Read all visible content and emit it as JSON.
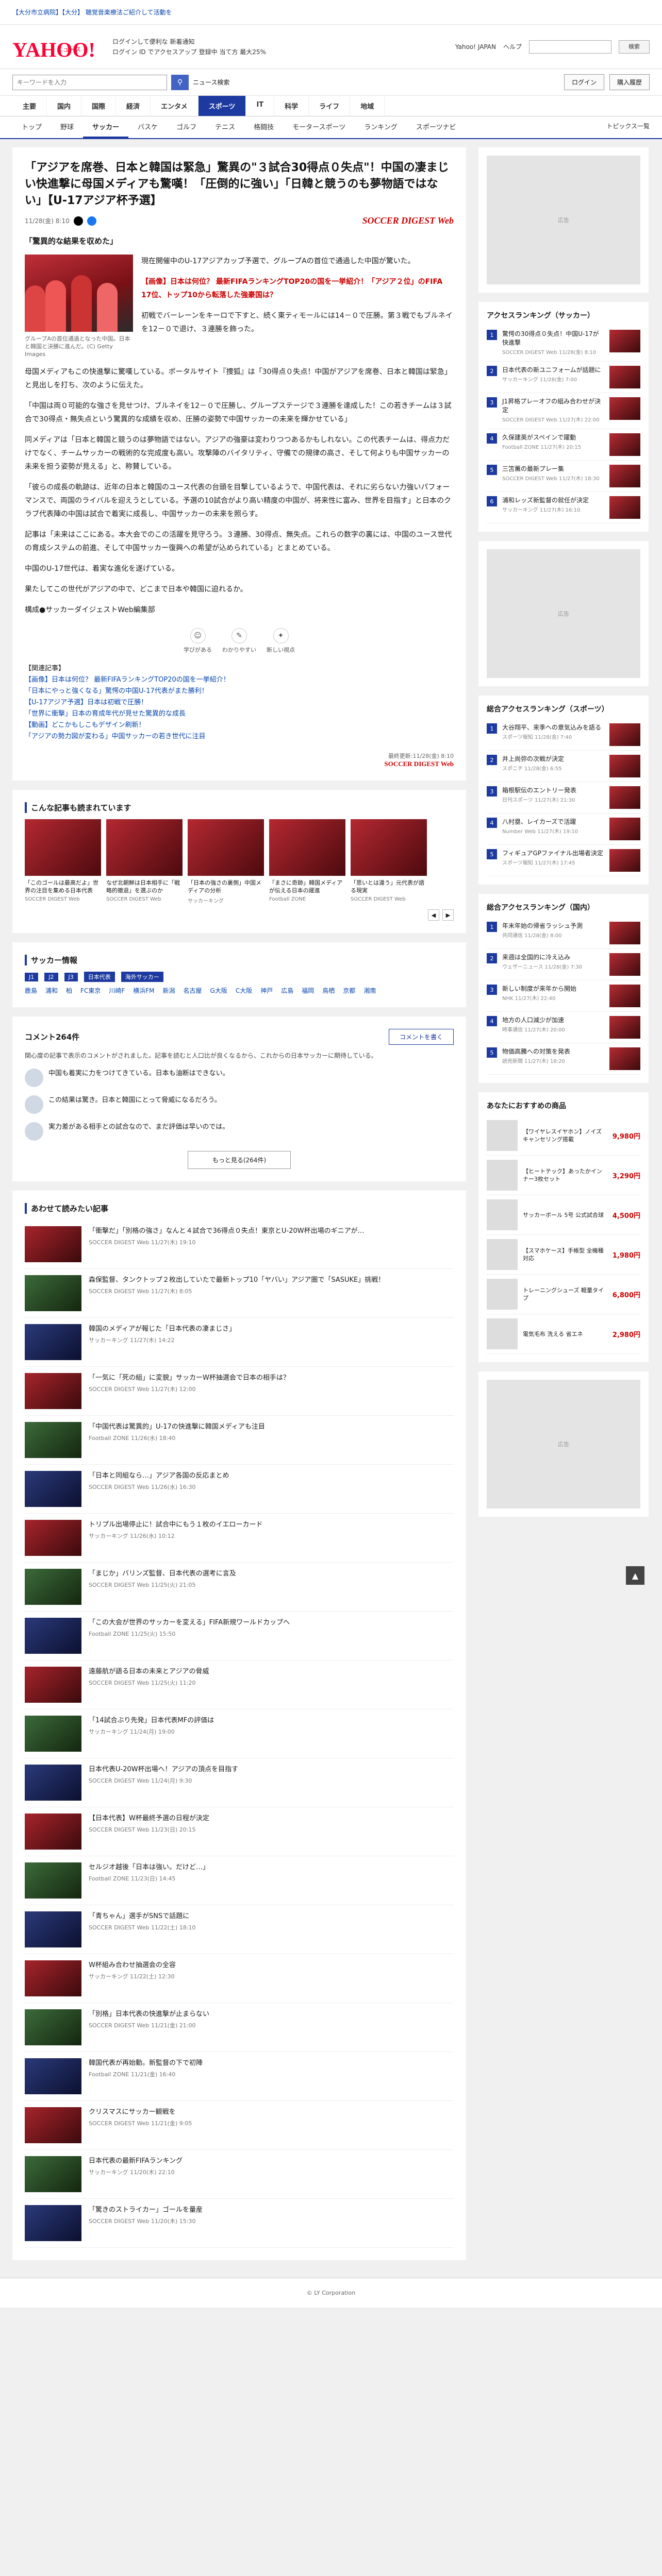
{
  "topbar": {
    "promo": "【大分市立病院】【大分】 聴覚音楽療法ご紹介して活動を"
  },
  "header": {
    "logo_text": "YAHOO!",
    "logo_sub": "ニュース",
    "line1": "ログインして便利な 新着通知",
    "line2": "ログイン ID でアクセスアップ 登録中 当て方 最大25%",
    "links": [
      "Yahoo! JAPAN",
      "ヘルプ"
    ],
    "search_btn": "検索"
  },
  "search": {
    "placeholder": "キーワードを入力",
    "btn": "ニュース検索",
    "right": [
      "ログイン",
      "購入履歴"
    ]
  },
  "mainnav": [
    "主要",
    "国内",
    "国際",
    "経済",
    "エンタメ",
    "スポーツ",
    "IT",
    "科学",
    "ライフ",
    "地域"
  ],
  "mainnav_active": 5,
  "subnav": [
    "トップ",
    "野球",
    "サッカー",
    "バスケ",
    "ゴルフ",
    "テニス",
    "格闘技",
    "モータースポーツ",
    "ランキング",
    "スポーツナビ"
  ],
  "subnav_active": 2,
  "subnav_right": "トピックス一覧",
  "article": {
    "title": "「アジアを席巻、日本と韓国は緊急」驚異の\"３試合30得点０失点\"！中国の凄まじい快進撃に母国メディアも驚嘆！「圧倒的に強い」「日韓と競うのも夢物語ではない」【U-17アジア杯予選】",
    "date": "11/28(金) 8:10",
    "brand": "SOCCER DIGEST Web",
    "lead": "「驚異的な結果を収めた」",
    "caption": "グループAの首位通過となった中国。日本と韓国と決勝に進んだ。(C) Getty Images",
    "p1": "現在開催中のU-17アジアカップ予選で、グループAの首位で通過した中国が驚いた。",
    "p2_red": "【画像】日本は何位？ 最新FIFAランキングTOP20の国を一挙紹介！「アジア２位」のFIFA 17位、トップ10から転落した強豪国は？",
    "p3": "初戦でバーレーンをキーロで下すと、続く東ティモールには14－０で圧勝。第３戦でもブルネイを12－０で退け、３連勝を飾った。",
    "p4": "母国メディアもこの快進撃に驚嘆している。ポータルサイト『捜狐』は「30得点０失点！中国がアジアを席巻、日本と韓国は緊急」と見出しを打ち、次のように伝えた。",
    "p5": "「中国は両０可能的な強さを見せつけ、ブルネイを12－０で圧勝し、グループステージで３連勝を達成した！この若きチームは３試合で30得点・無失点という驚異的な成績を収め、圧勝の姿勢で中国サッカーの未来を輝かせている」",
    "p6": "同メディアは「日本と韓国と競うのは夢物語ではない。アジアの強豪は変わりつつあるかもしれない。この代表チームは、得点力だけでなく、チームサッカーの戦術的な完成度も高い。攻撃陣のバイタリティ、守備での規律の高さ、そして何よりも中国サッカーの未来を担う姿勢が見える」と、称賛している。",
    "p7": "「彼らの成長の軌跡は、近年の日本と韓国のユース代表の台頭を目撃しているようで、中国代表は、それに劣らない力強いパフォーマンスで、両国のライバルを迎えうとしている。予選の10試合がより高い精度の中国が、将来性に富み、世界を目指す」と日本のクラブ代表陣の中国は試合で着実に成長し、中国サッカーの未来を照らす。",
    "p8": "記事は「未来はここにある。本大会でのこの活躍を見守ろう。３連勝、30得点、無失点。これらの数字の裏には、中国のユース世代の育成システムの前進、そして中国サッカー復興への希望が込められている」とまとめている。",
    "p9": "中国のU-17世代は、着実な進化を遂げている。",
    "p10": "果たしてこの世代がアジアの中で、どこまで日本や韓国に迫れるか。",
    "p11": "構成●サッカーダイジェストWeb編集部",
    "reactions": [
      {
        "icon": "☺",
        "label": "学びがある"
      },
      {
        "icon": "✎",
        "label": "わかりやすい"
      },
      {
        "icon": "✦",
        "label": "新しい視点"
      }
    ],
    "related_head": "【関連記事】",
    "related": [
      "【画像】日本は何位？ 最新FIFAランキングTOP20の国を一挙紹介！",
      "「日本にやっと強くなる」驚愕の中国U-17代表がまた勝利！",
      "【U-17アジア予選】日本は初戦で圧勝！",
      "「世界に衝撃」日本の育成年代が見せた驚異的な成長",
      "【動画】どこかもしこもデザイン刷新！",
      "「アジアの勢力図が変わる」中国サッカーの若き世代に注目"
    ],
    "foot_date": "最終更新:11/28(金) 8:10",
    "foot_brand": "SOCCER DIGEST Web"
  },
  "carousel": {
    "title": "こんな記事も読まれています",
    "items": [
      {
        "t": "「このゴールは最高だよ」世界の注目を集める日本代表",
        "s": "SOCCER DIGEST Web"
      },
      {
        "t": "なぜ北朝鮮は日本相手に「戦略的撤退」を選ぶのか",
        "s": "SOCCER DIGEST Web"
      },
      {
        "t": "「日本の強さの裏側」中国メディアの分析",
        "s": "サッカーキング"
      },
      {
        "t": "「まさに奇跡」韓国メディアが伝える日本の躍進",
        "s": "Football ZONE"
      },
      {
        "t": "「思いとは違う」元代表が語る現実",
        "s": "SOCCER DIGEST Web"
      }
    ]
  },
  "soccer_info": {
    "title": "サッカー情報",
    "links": [
      "J1",
      "J2",
      "J3",
      "日本代表",
      "海外サッカー"
    ],
    "teams": [
      "鹿島",
      "浦和",
      "柏",
      "FC東京",
      "川崎F",
      "横浜FM",
      "新潟",
      "名古屋",
      "G大阪",
      "C大阪",
      "神戸",
      "広島",
      "福岡",
      "鳥栖",
      "京都",
      "湘南"
    ]
  },
  "comments": {
    "title": "コメント264件",
    "btn": "コメントを書く",
    "note": "関心度の記事で表示のコメントがされました。記事を読むと人口比が良くなるから、これからの日本サッカーに期待している。",
    "items": [
      {
        "text": "中国も着実に力をつけてきている。日本も油断はできない。"
      },
      {
        "text": "この結果は驚き。日本と韓国にとって脅威になるだろう。"
      },
      {
        "text": "実力差がある相手との試合なので、まだ評価は早いのでは。"
      }
    ],
    "more": "もっと見る(264件)"
  },
  "feed": {
    "title": "あわせて読みたい記事",
    "items": [
      {
        "t": "「衝撃だ」「別格の強さ」なんと４試合で36得点０失点！東京とU-20W杯出場のギニアが…",
        "s": "SOCCER DIGEST Web 11/27(木) 19:10"
      },
      {
        "t": "森保監督、タンクトップ２枚出していたで最新トップ10「ヤバい」アジア圏で「SASUKE」挑戦！",
        "s": "SOCCER DIGEST Web 11/27(木) 8:05"
      },
      {
        "t": "韓国のメディアが報じた「日本代表の凄まじさ」",
        "s": "サッカーキング 11/27(木) 14:22"
      },
      {
        "t": "「一気に「死の組」に変貌」サッカーW杯抽選会で日本の相手は？",
        "s": "SOCCER DIGEST Web 11/27(木) 12:00"
      },
      {
        "t": "「中国代表は驚異的」U-17の快進撃に韓国メディアも注目",
        "s": "Football ZONE 11/26(水) 18:40"
      },
      {
        "t": "「日本と同組なら…」アジア各国の反応まとめ",
        "s": "SOCCER DIGEST Web 11/26(水) 16:30"
      },
      {
        "t": "トリプル出場停止に！試合中にもう１枚のイエローカード",
        "s": "サッカーキング 11/26(水) 10:12"
      },
      {
        "t": "「まじか」バリンズ監督、日本代表の選考に言及",
        "s": "SOCCER DIGEST Web 11/25(火) 21:05"
      },
      {
        "t": "「この大会が世界のサッカーを変える」FIFA新規ワールドカップへ",
        "s": "Football ZONE 11/25(火) 15:50"
      },
      {
        "t": "遠藤航が語る日本の未来とアジアの脅威",
        "s": "SOCCER DIGEST Web 11/25(火) 11:20"
      },
      {
        "t": "「14試合ぶり先発」日本代表MFの評価は",
        "s": "サッカーキング 11/24(月) 19:00"
      },
      {
        "t": "日本代表U-20W杯出場へ！アジアの頂点を目指す",
        "s": "SOCCER DIGEST Web 11/24(月) 9:30"
      },
      {
        "t": "【日本代表】W杯最終予選の日程が決定",
        "s": "SOCCER DIGEST Web 11/23(日) 20:15"
      },
      {
        "t": "セルジオ越後「日本は強い。だけど…」",
        "s": "Football ZONE 11/23(日) 14:45"
      },
      {
        "t": "「青ちゃん」選手がSNSで話題に",
        "s": "SOCCER DIGEST Web 11/22(土) 18:10"
      },
      {
        "t": "W杯組み合わせ抽選会の全容",
        "s": "サッカーキング 11/22(土) 12:30"
      },
      {
        "t": "「別格」日本代表の快進撃が止まらない",
        "s": "SOCCER DIGEST Web 11/21(金) 21:00"
      },
      {
        "t": "韓国代表が再始動。新監督の下で初陣",
        "s": "Football ZONE 11/21(金) 16:40"
      },
      {
        "t": "クリスマスにサッカー観戦を",
        "s": "SOCCER DIGEST Web 11/21(金) 9:05"
      },
      {
        "t": "日本代表の最新FIFAランキング",
        "s": "サッカーキング 11/20(木) 22:10"
      },
      {
        "t": "「驚きのストライカー」ゴールを量産",
        "s": "SOCCER DIGEST Web 11/20(木) 15:30"
      }
    ]
  },
  "side": {
    "ranking_title": "アクセスランキング（サッカー）",
    "ranking": [
      {
        "t": "驚愕の30得点０失点！中国U-17が快進撃",
        "s": "SOCCER DIGEST Web 11/28(金) 8:10"
      },
      {
        "t": "日本代表の新ユニフォームが話題に",
        "s": "サッカーキング 11/28(金) 7:00"
      },
      {
        "t": "J1昇格プレーオフの組み合わせが決定",
        "s": "SOCCER DIGEST Web 11/27(木) 22:00"
      },
      {
        "t": "久保建英がスペインで躍動",
        "s": "Football ZONE 11/27(木) 20:15"
      },
      {
        "t": "三笘薫の最新プレー集",
        "s": "SOCCER DIGEST Web 11/27(木) 18:30"
      },
      {
        "t": "浦和レッズ新監督の就任が決定",
        "s": "サッカーキング 11/27(木) 16:10"
      }
    ],
    "ranking2_title": "総合アクセスランキング（スポーツ）",
    "ranking2": [
      {
        "t": "大谷翔平、来季への意気込みを語る",
        "s": "スポーツ報知 11/28(金) 7:40"
      },
      {
        "t": "井上尚弥の次戦が決定",
        "s": "スポニチ 11/28(金) 6:55"
      },
      {
        "t": "箱根駅伝のエントリー発表",
        "s": "日刊スポーツ 11/27(木) 21:30"
      },
      {
        "t": "八村塁、レイカーズで活躍",
        "s": "Number Web 11/27(木) 19:10"
      },
      {
        "t": "フィギュアGPファイナル出場者決定",
        "s": "スポーツ報知 11/27(木) 17:45"
      }
    ],
    "ranking3_title": "総合アクセスランキング（国内）",
    "ranking3": [
      {
        "t": "年末年始の帰省ラッシュ予測",
        "s": "共同通信 11/28(金) 8:00"
      },
      {
        "t": "来週は全国的に冷え込み",
        "s": "ウェザーニュース 11/28(金) 7:30"
      },
      {
        "t": "新しい制度が来年から開始",
        "s": "NHK 11/27(木) 22:40"
      },
      {
        "t": "地方の人口減少が加速",
        "s": "時事通信 11/27(木) 20:00"
      },
      {
        "t": "物価高騰への対策を発表",
        "s": "読売新聞 11/27(木) 18:20"
      }
    ],
    "shop_title": "あなたにおすすめの商品",
    "shop": [
      {
        "t": "【ワイヤレスイヤホン】ノイズキャンセリング搭載",
        "p": "9,980円"
      },
      {
        "t": "【ヒートテック】あったかインナー3枚セット",
        "p": "3,290円"
      },
      {
        "t": "サッカーボール 5号 公式試合球",
        "p": "4,500円"
      },
      {
        "t": "【スマホケース】手帳型 全機種対応",
        "p": "1,980円"
      },
      {
        "t": "トレーニングシューズ 軽量タイプ",
        "p": "6,800円"
      },
      {
        "t": "電気毛布 洗える 省エネ",
        "p": "2,980円"
      }
    ],
    "ad_label": "広告"
  },
  "footer": {
    "text": "© LY Corporation"
  },
  "topbtn": "▲"
}
